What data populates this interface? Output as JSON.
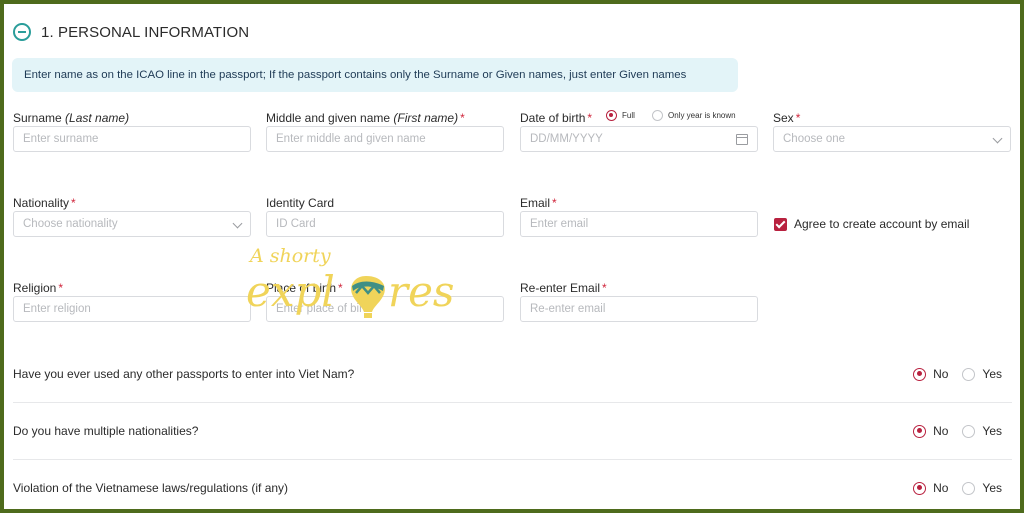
{
  "section": {
    "title": "1. PERSONAL INFORMATION"
  },
  "notice": "Enter name as on the ICAO line in the passport; If the passport contains only the Surname or Given names, just enter Given names",
  "fields": {
    "surname": {
      "label": "Surname",
      "hint": "(Last name)",
      "placeholder": "Enter surname"
    },
    "given_name": {
      "label": "Middle and given name",
      "hint": "(First name)",
      "required": "*",
      "placeholder": "Enter middle and given name"
    },
    "dob": {
      "label": "Date of birth",
      "required": "*",
      "option_full": "Full",
      "option_year": "Only year is known",
      "placeholder": "DD/MM/YYYY"
    },
    "sex": {
      "label": "Sex",
      "required": "*",
      "placeholder": "Choose one"
    },
    "nationality": {
      "label": "Nationality",
      "required": "*",
      "placeholder": "Choose nationality"
    },
    "identity_card": {
      "label": "Identity Card",
      "placeholder": "ID Card"
    },
    "email": {
      "label": "Email",
      "required": "*",
      "placeholder": "Enter email"
    },
    "religion": {
      "label": "Religion",
      "required": "*",
      "placeholder": "Enter religion"
    },
    "place_of_birth": {
      "label": "Place of birth",
      "required": "*",
      "placeholder": "Enter place of birth"
    },
    "reenter_email": {
      "label": "Re-enter Email",
      "required": "*",
      "placeholder": "Re-enter email"
    }
  },
  "agree": {
    "label": "Agree to create account by email",
    "checked": true
  },
  "questions": [
    {
      "text": "Have you ever used any other passports to enter into Viet Nam?",
      "no": "No",
      "yes": "Yes",
      "selected": "No"
    },
    {
      "text": "Do you have multiple nationalities?",
      "no": "No",
      "yes": "Yes",
      "selected": "No"
    },
    {
      "text": "Violation of the Vietnamese laws/regulations (if any)",
      "no": "No",
      "yes": "Yes",
      "selected": "No"
    }
  ],
  "watermark": {
    "line1": "A shorty",
    "line2": "expl",
    "line3": "res"
  },
  "colors": {
    "accent": "#b8213f",
    "teal": "#2a9d9a",
    "notice_bg": "#e3f4f8",
    "frame": "#4e6b1c",
    "watermark": "#f0d45a"
  }
}
